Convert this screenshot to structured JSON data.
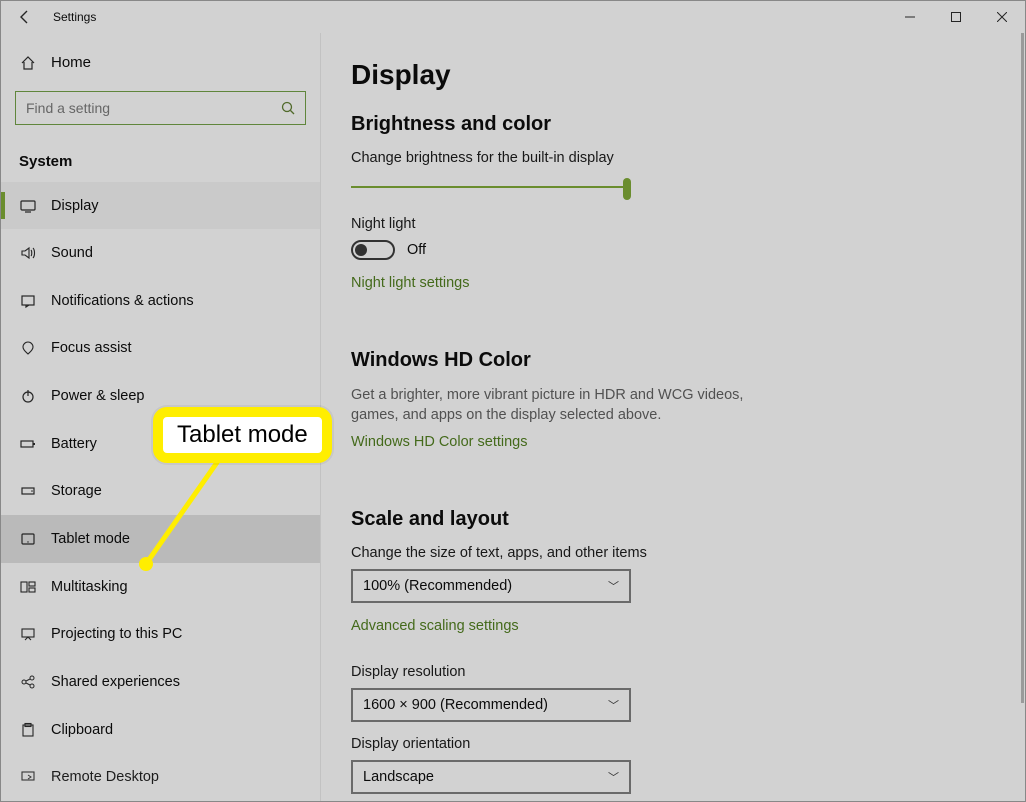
{
  "window": {
    "title": "Settings"
  },
  "sidebar": {
    "home": "Home",
    "search_placeholder": "Find a setting",
    "category": "System",
    "items": [
      {
        "label": "Display"
      },
      {
        "label": "Sound"
      },
      {
        "label": "Notifications & actions"
      },
      {
        "label": "Focus assist"
      },
      {
        "label": "Power & sleep"
      },
      {
        "label": "Battery"
      },
      {
        "label": "Storage"
      },
      {
        "label": "Tablet mode"
      },
      {
        "label": "Multitasking"
      },
      {
        "label": "Projecting to this PC"
      },
      {
        "label": "Shared experiences"
      },
      {
        "label": "Clipboard"
      },
      {
        "label": "Remote Desktop"
      }
    ]
  },
  "content": {
    "page_title": "Display",
    "brightness": {
      "heading": "Brightness and color",
      "label": "Change brightness for the built-in display",
      "night_light_label": "Night light",
      "night_light_value": "Off",
      "link": "Night light settings"
    },
    "hd": {
      "heading": "Windows HD Color",
      "desc": "Get a brighter, more vibrant picture in HDR and WCG videos, games, and apps on the display selected above.",
      "link": "Windows HD Color settings"
    },
    "scale": {
      "heading": "Scale and layout",
      "size_label": "Change the size of text, apps, and other items",
      "size_value": "100% (Recommended)",
      "adv_link": "Advanced scaling settings",
      "res_label": "Display resolution",
      "res_value": "1600 × 900 (Recommended)",
      "orient_label": "Display orientation",
      "orient_value": "Landscape"
    }
  },
  "callout": {
    "text": "Tablet mode"
  }
}
